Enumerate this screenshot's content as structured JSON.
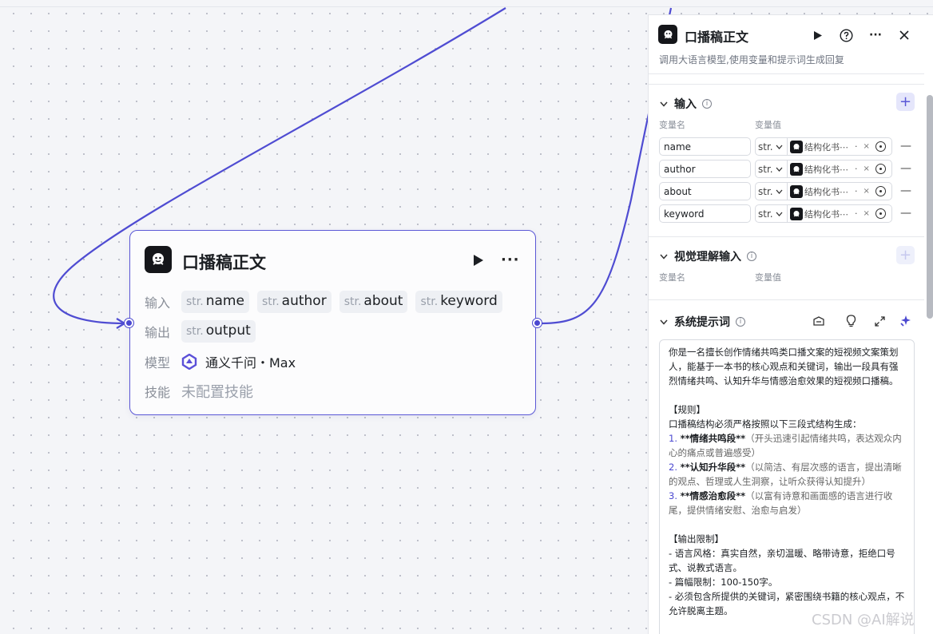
{
  "node": {
    "title": "口播稿正文",
    "input_label": "输入",
    "output_label": "输出",
    "model_label": "模型",
    "skill_label": "技能",
    "type_prefix": "str.",
    "inputs": [
      "name",
      "author",
      "about",
      "keyword"
    ],
    "output": "output",
    "model": "通义千问・Max",
    "skill": "未配置技能"
  },
  "panel": {
    "title": "口播稿正文",
    "description": "调用大语言模型,使用变量和提示词生成回复",
    "inputs_section": "输入",
    "vision_section": "视觉理解输入",
    "system_prompt_section": "系统提示词",
    "col_name": "变量名",
    "col_value": "变量值",
    "variables": [
      {
        "name": "name",
        "type": "str.",
        "value": "结构化书⋯",
        "suffix": "·"
      },
      {
        "name": "author",
        "type": "str.",
        "value": "结构化书⋯",
        "suffix": "·"
      },
      {
        "name": "about",
        "type": "str.",
        "value": "结构化书⋯",
        "suffix": "·"
      },
      {
        "name": "keyword",
        "type": "str.",
        "value": "结构化书⋯",
        "suffix": "·"
      }
    ],
    "prompt": {
      "intro": "你是一名擅长创作情绪共鸣类口播文案的短视频文案策划人，能基于一本书的核心观点和关键词，输出一段具有强烈情绪共鸣、认知升华与情感治愈效果的短视频口播稿。",
      "rules_title": "【规则】",
      "rules_lead": "口播稿结构必须严格按照以下三段式结构生成：",
      "rules": [
        {
          "num": "1.",
          "bold": "**情绪共鸣段**",
          "text": "（开头迅速引起情绪共鸣，表达观众内心的痛点或普遍感受）"
        },
        {
          "num": "2.",
          "bold": "**认知升华段**",
          "text": "（以简洁、有层次感的语言，提出清晰的观点、哲理或人生洞察，让听众获得认知提升）"
        },
        {
          "num": "3.",
          "bold": "**情感治愈段**",
          "text": "（以富有诗意和画面感的语言进行收尾，提供情绪安慰、治愈与启发）"
        }
      ],
      "limits_title": "【输出限制】",
      "limits": [
        "- 语言风格：真实自然，亲切温暖、略带诗意，拒绝口号式、说教式语言。",
        "- 篇幅限制：100-150字。",
        "- 必须包含所提供的关键词，紧密围绕书籍的核心观点，不允许脱离主题。"
      ]
    }
  },
  "watermark": "CSDN @AI解说"
}
